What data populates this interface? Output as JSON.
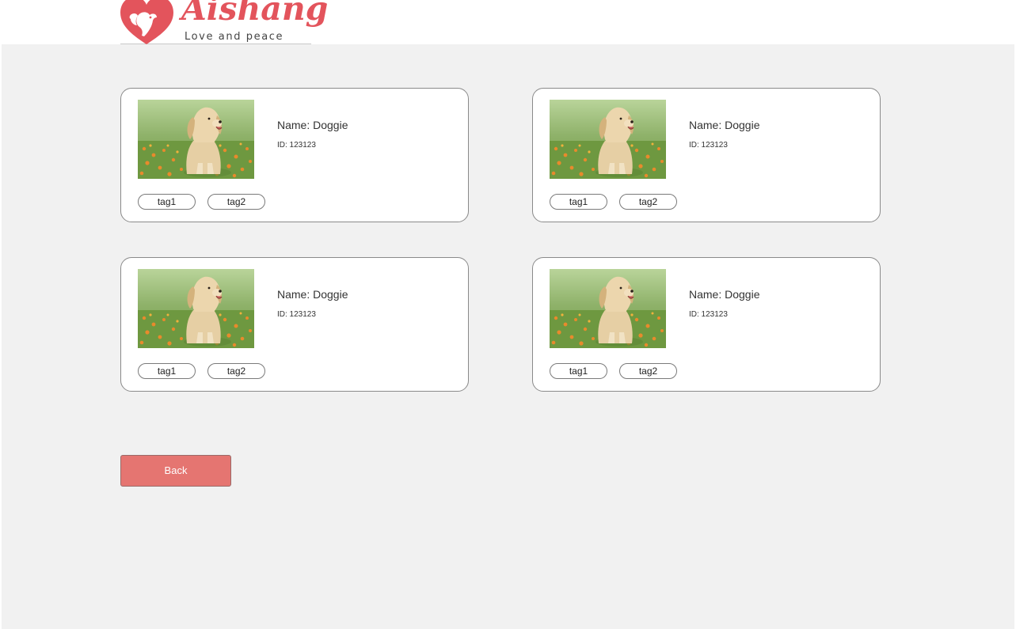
{
  "header": {
    "logo": {
      "word": "Aishang",
      "tagline": "Love and peace",
      "brand_color": "#e3545c"
    }
  },
  "pets": [
    {
      "name": "Name: Doggie",
      "id": "ID: 123123",
      "tags": [
        "tag1",
        "tag2"
      ]
    },
    {
      "name": "Name: Doggie",
      "id": "ID: 123123",
      "tags": [
        "tag1",
        "tag2"
      ]
    },
    {
      "name": "Name: Doggie",
      "id": "ID: 123123",
      "tags": [
        "tag1",
        "tag2"
      ]
    },
    {
      "name": "Name: Doggie",
      "id": "ID: 123123",
      "tags": [
        "tag1",
        "tag2"
      ]
    }
  ],
  "actions": {
    "back_label": "Back",
    "back_color": "#e57571"
  },
  "colors": {
    "page_background": "#f1f1f1",
    "card_border": "#8a8a8a"
  }
}
